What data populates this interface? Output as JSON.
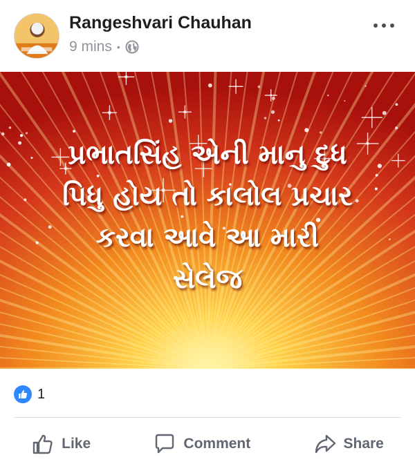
{
  "post": {
    "author": "Rangeshvari Chauhan",
    "time": "9 mins",
    "separator": "•",
    "audience_icon": "globe-icon",
    "menu_icon": "more-options-icon",
    "image_text_lines": [
      "પ્રભાતસિંહ એની માનુ દુધ",
      "પિધુ હોય તો કાલોલ પ્રચાર",
      "કરવા આવે આ મારી",
      "સેલેજ"
    ],
    "image_colors": {
      "center": "#ffe680",
      "mid": "#f28a1e",
      "edge": "#b3150d",
      "text": "#ffffff"
    }
  },
  "reactions": {
    "icon": "like-icon",
    "count": "1",
    "color": "#2d88ff"
  },
  "actions": {
    "like": "Like",
    "comment": "Comment",
    "share": "Share"
  }
}
